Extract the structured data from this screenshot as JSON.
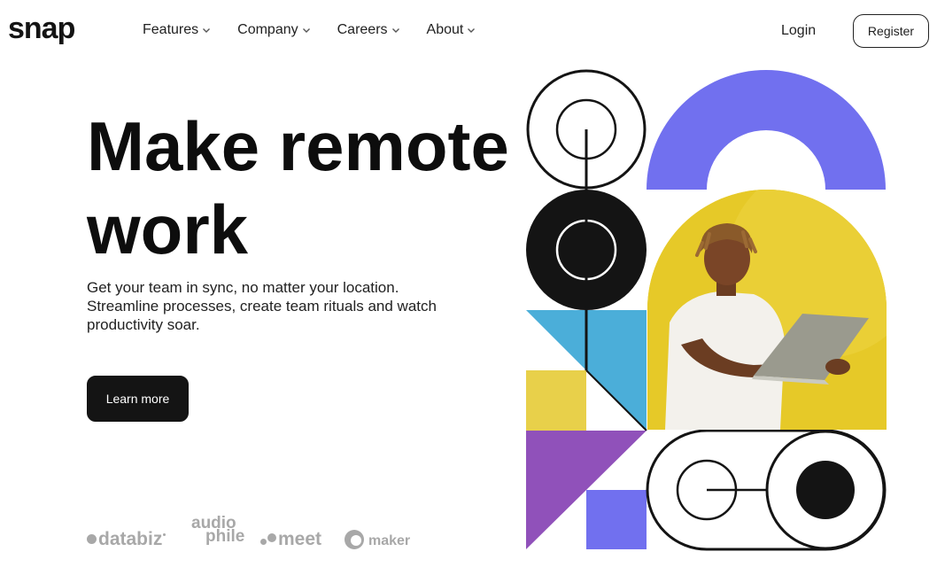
{
  "brand": {
    "logo": "snap"
  },
  "nav": {
    "items": [
      {
        "label": "Features"
      },
      {
        "label": "Company"
      },
      {
        "label": "Careers"
      },
      {
        "label": "About"
      }
    ],
    "login_label": "Login",
    "register_label": "Register"
  },
  "hero": {
    "headline_line1": "Make remote",
    "headline_line2": "work",
    "sub_line1": "Get your team in sync, no matter your location.",
    "sub_line2": "Streamline processes, create team rituals and watch",
    "sub_line3": "productivity soar.",
    "cta_label": "Learn more"
  },
  "clients": {
    "databiz": "databiz",
    "audiophile_top": "audio",
    "audiophile_bottom": "phile",
    "meet": "meet",
    "maker": "maker"
  },
  "colors": {
    "purple_arch": "#7170ef",
    "yellow": "#e8c93f",
    "blue": "#4baed9",
    "violet": "#9051ba",
    "dark": "#141414"
  },
  "icons": {
    "chevron": "chevron-down-icon"
  }
}
